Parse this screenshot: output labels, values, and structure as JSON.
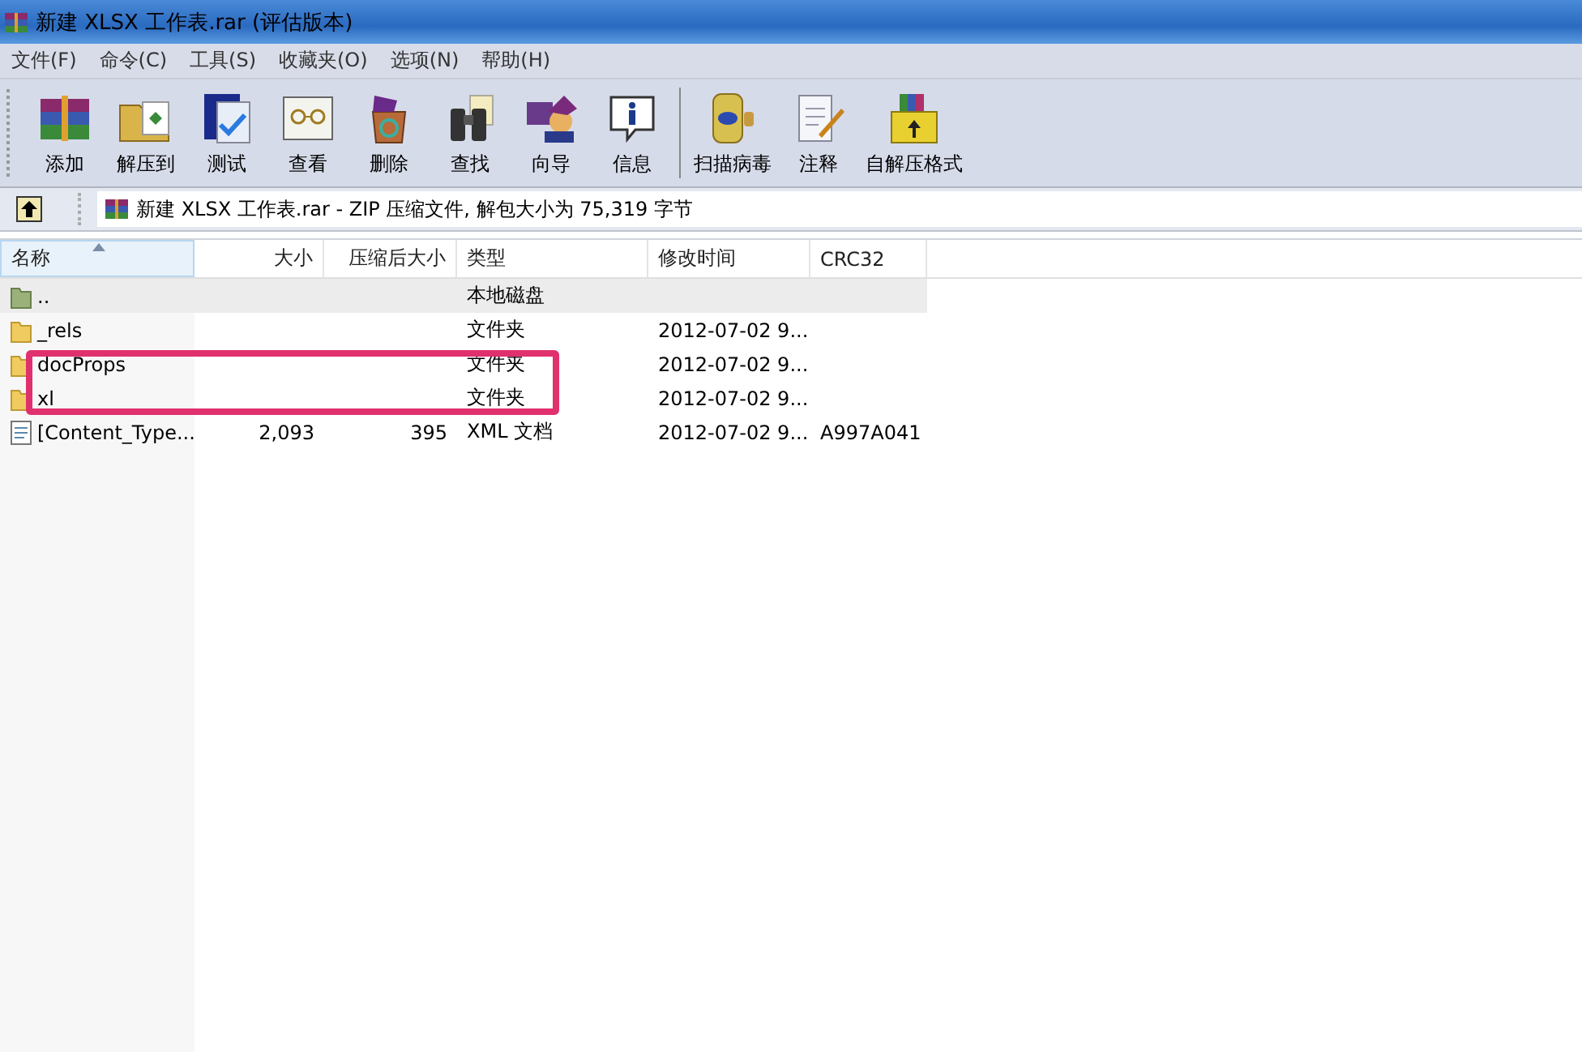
{
  "window": {
    "title": "新建 XLSX 工作表.rar (评估版本)"
  },
  "menu": [
    "文件(F)",
    "命令(C)",
    "工具(S)",
    "收藏夹(O)",
    "选项(N)",
    "帮助(H)"
  ],
  "toolbar": [
    {
      "label": "添加",
      "kind": "books"
    },
    {
      "label": "解压到",
      "kind": "folder"
    },
    {
      "label": "测试",
      "kind": "check"
    },
    {
      "label": "查看",
      "kind": "glasses"
    },
    {
      "label": "删除",
      "kind": "recycle"
    },
    {
      "label": "查找",
      "kind": "binoculars"
    },
    {
      "label": "向导",
      "kind": "wizard"
    },
    {
      "label": "信息",
      "kind": "info"
    },
    {
      "label": "扫描病毒",
      "kind": "bug"
    },
    {
      "label": "注释",
      "kind": "note"
    },
    {
      "label": "自解压格式",
      "kind": "box"
    }
  ],
  "address": {
    "text": "新建 XLSX 工作表.rar - ZIP 压缩文件, 解包大小为 75,319 字节"
  },
  "table": {
    "columns": [
      "名称",
      "大小",
      "压缩后大小",
      "类型",
      "修改时间",
      "CRC32"
    ],
    "rows": [
      {
        "kind": "drive",
        "selected": true,
        "cells": [
          "..",
          "",
          "",
          "本地磁盘",
          "",
          ""
        ]
      },
      {
        "kind": "folder",
        "selected": false,
        "cells": [
          "_rels",
          "",
          "",
          "文件夹",
          "2012-07-02 9...",
          ""
        ]
      },
      {
        "kind": "folder",
        "selected": false,
        "cells": [
          "docProps",
          "",
          "",
          "文件夹",
          "2012-07-02 9...",
          ""
        ]
      },
      {
        "kind": "folder",
        "selected": false,
        "cells": [
          "xl",
          "",
          "",
          "文件夹",
          "2012-07-02 9...",
          ""
        ]
      },
      {
        "kind": "file",
        "selected": false,
        "cells": [
          "[Content_Type...",
          "2,093",
          "395",
          "XML 文档",
          "2012-07-02 9...",
          "A997A041"
        ]
      }
    ]
  }
}
